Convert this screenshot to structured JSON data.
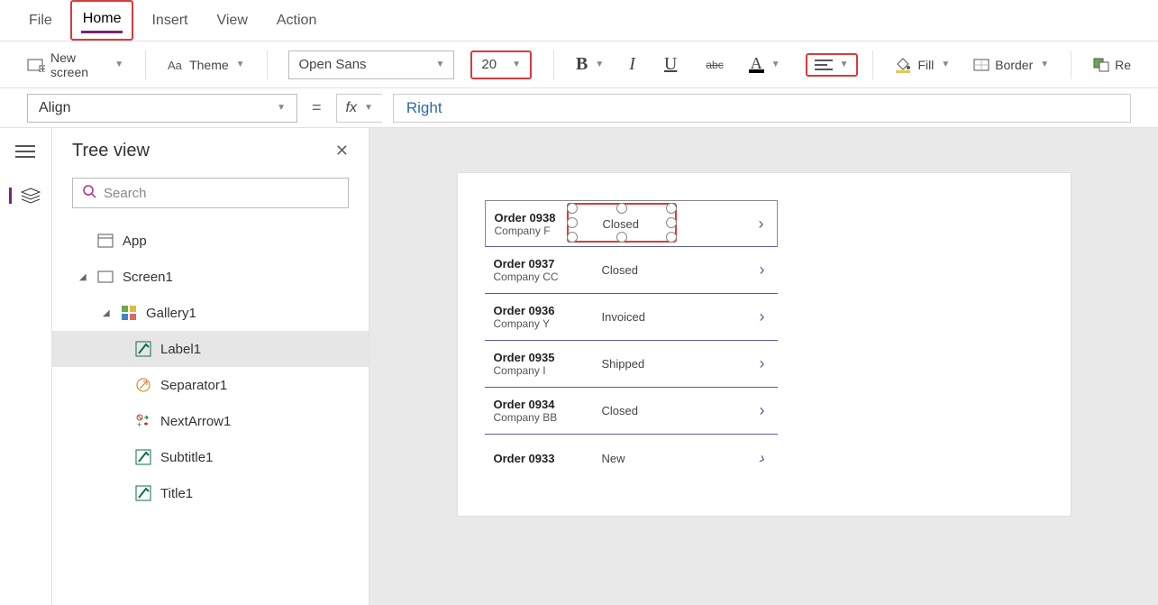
{
  "menu": {
    "tabs": [
      "File",
      "Home",
      "Insert",
      "View",
      "Action"
    ],
    "active": "Home"
  },
  "ribbon": {
    "new_screen": "New screen",
    "theme": "Theme",
    "font_family": "Open Sans",
    "font_size": "20",
    "fill": "Fill",
    "border": "Border",
    "reorder": "Re"
  },
  "formula": {
    "property": "Align",
    "fx": "fx",
    "value": "Right"
  },
  "tree": {
    "title": "Tree view",
    "search_placeholder": "Search",
    "items": {
      "app": "App",
      "screen1": "Screen1",
      "gallery1": "Gallery1",
      "label1": "Label1",
      "separator1": "Separator1",
      "nextarrow1": "NextArrow1",
      "subtitle1": "Subtitle1",
      "title1": "Title1"
    }
  },
  "gallery": {
    "rows": [
      {
        "title": "Order 0938",
        "sub": "Company F",
        "status": "Closed"
      },
      {
        "title": "Order 0937",
        "sub": "Company CC",
        "status": "Closed"
      },
      {
        "title": "Order 0936",
        "sub": "Company Y",
        "status": "Invoiced"
      },
      {
        "title": "Order 0935",
        "sub": "Company I",
        "status": "Shipped"
      },
      {
        "title": "Order 0934",
        "sub": "Company BB",
        "status": "Closed"
      },
      {
        "title": "Order 0933",
        "sub": "",
        "status": "New"
      }
    ]
  }
}
